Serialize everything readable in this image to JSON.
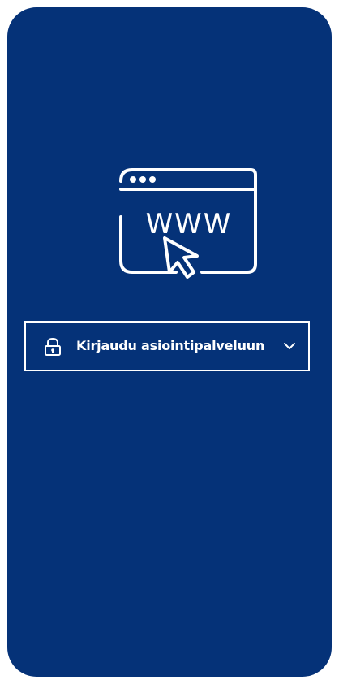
{
  "login": {
    "label": "Kirjaudu asiointipalveluun",
    "lock_icon": "lock-icon",
    "chevron_icon": "chevron-down-icon"
  },
  "illustration": {
    "text": "WWW",
    "icon": "web-browser-click-icon"
  },
  "colors": {
    "background": "#053278",
    "foreground": "#ffffff",
    "page": "#ffffff"
  }
}
